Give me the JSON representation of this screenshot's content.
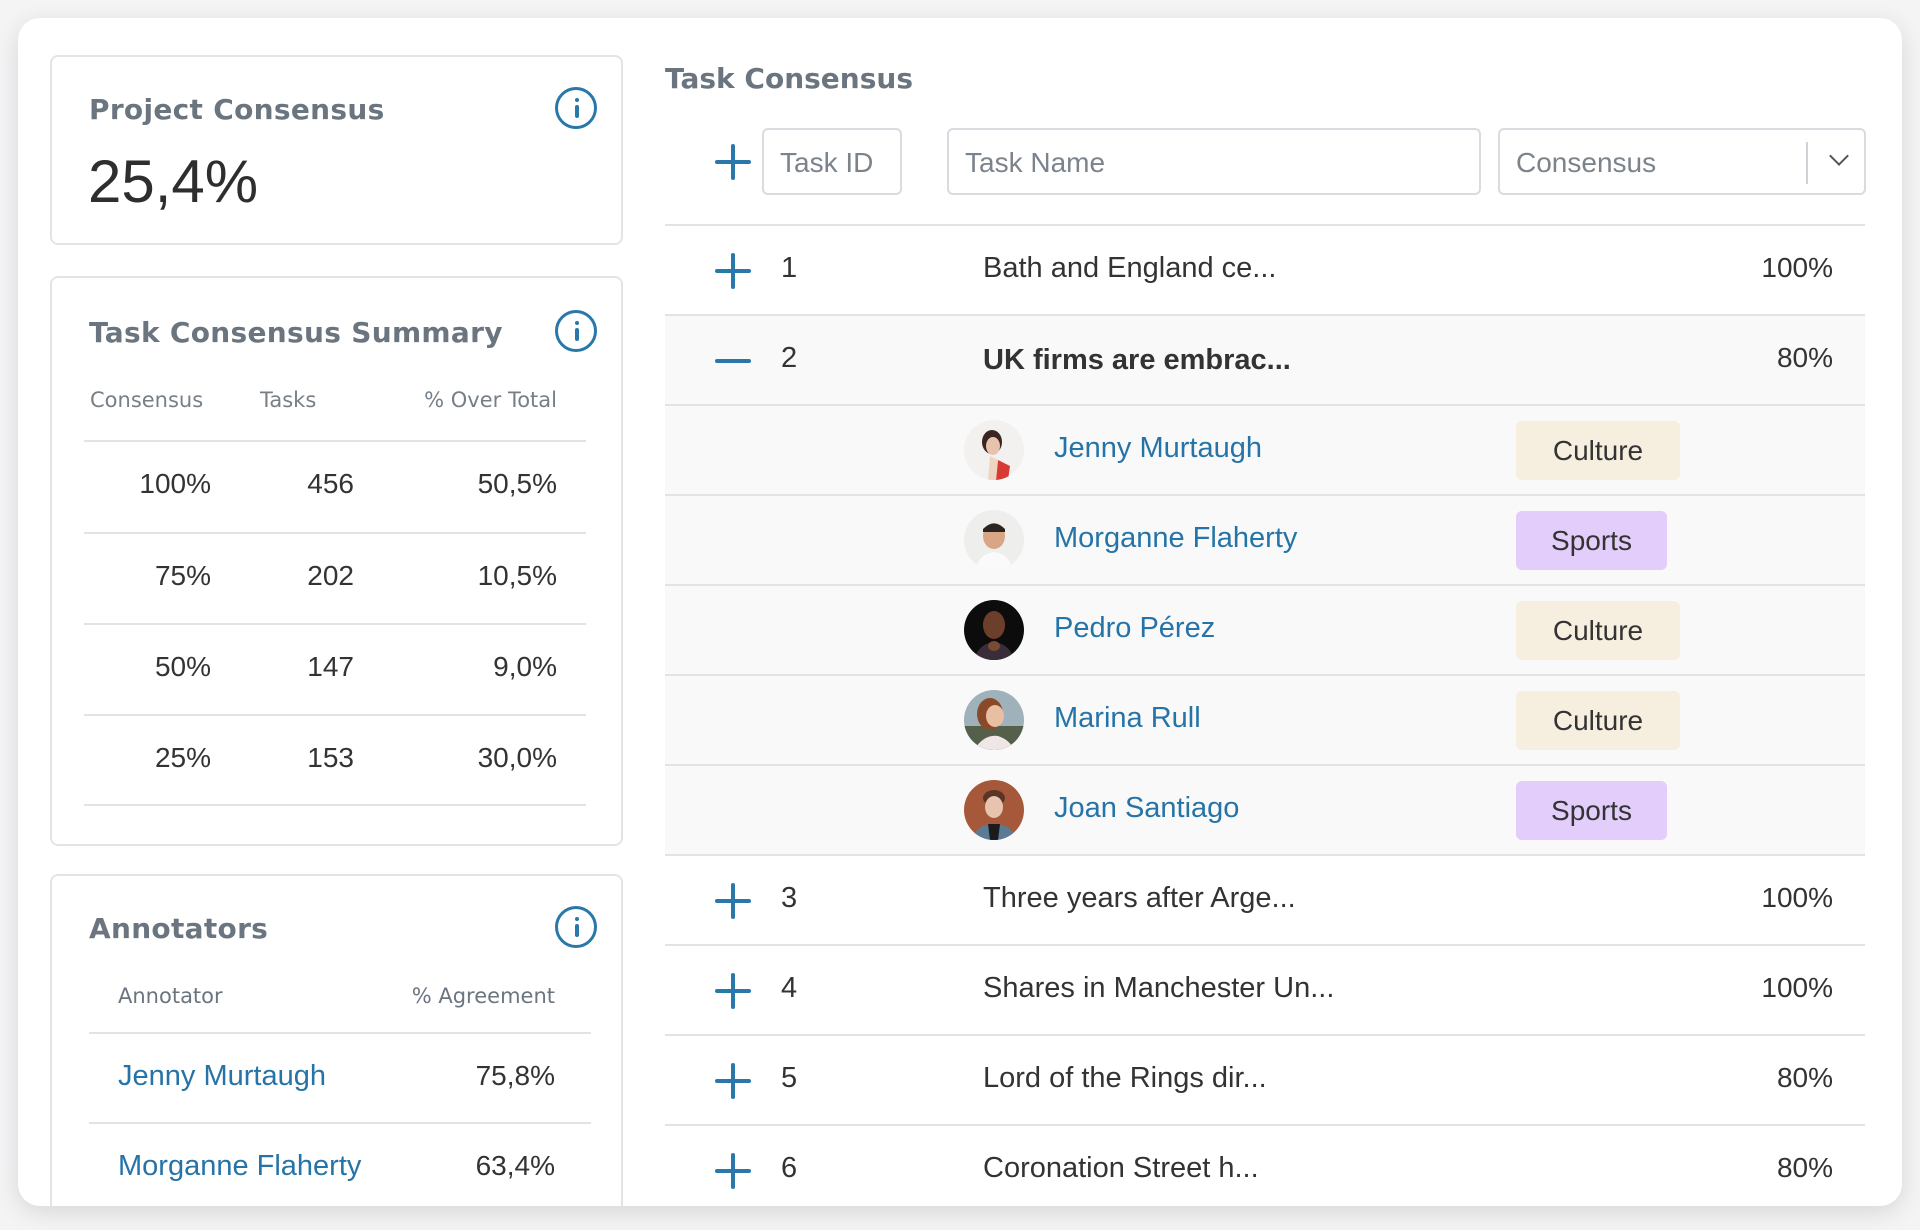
{
  "project_consensus": {
    "title": "Project Consensus",
    "value": "25,4%",
    "info_icon": "info-icon"
  },
  "summary": {
    "title": "Task Consensus Summary",
    "info_icon": "info-icon",
    "headers": [
      "Consensus",
      "Tasks",
      "% Over Total"
    ],
    "rows": [
      {
        "consensus": "100%",
        "tasks": "456",
        "pct": "50,5%"
      },
      {
        "consensus": "75%",
        "tasks": "202",
        "pct": "10,5%"
      },
      {
        "consensus": "50%",
        "tasks": "147",
        "pct": "9,0%"
      },
      {
        "consensus": "25%",
        "tasks": "153",
        "pct": "30,0%"
      }
    ]
  },
  "annotators": {
    "title": "Annotators",
    "info_icon": "info-icon",
    "headers": [
      "Annotator",
      "% Agreement"
    ],
    "rows": [
      {
        "name": "Jenny Murtaugh",
        "agreement": "75,8%"
      },
      {
        "name": "Morganne Flaherty",
        "agreement": "63,4%"
      }
    ]
  },
  "task_consensus": {
    "title": "Task Consensus",
    "filters": {
      "task_id_placeholder": "Task ID",
      "task_name_placeholder": "Task Name",
      "consensus_select": "Consensus"
    },
    "tasks": [
      {
        "id": "1",
        "name": "Bath and England ce...",
        "consensus": "100%",
        "expanded": false
      },
      {
        "id": "2",
        "name": "UK firms are embrac...",
        "consensus": "80%",
        "expanded": true,
        "annotations": [
          {
            "annotator": "Jenny Murtaugh",
            "label": "Culture"
          },
          {
            "annotator": "Morganne Flaherty",
            "label": "Sports"
          },
          {
            "annotator": "Pedro Pérez",
            "label": "Culture"
          },
          {
            "annotator": "Marina Rull",
            "label": "Culture"
          },
          {
            "annotator": "Joan Santiago",
            "label": "Sports"
          }
        ]
      },
      {
        "id": "3",
        "name": "Three years after Arge...",
        "consensus": "100%",
        "expanded": false
      },
      {
        "id": "4",
        "name": "Shares in Manchester Un...",
        "consensus": "100%",
        "expanded": false
      },
      {
        "id": "5",
        "name": "Lord of the Rings dir...",
        "consensus": "80%",
        "expanded": false
      },
      {
        "id": "6",
        "name": "Coronation Street h...",
        "consensus": "80%",
        "expanded": false
      }
    ]
  },
  "colors": {
    "accent": "#2a78aa",
    "link": "#2674a7",
    "culture_tag": "#f6efdf",
    "sports_tag": "#e2cdfb"
  }
}
